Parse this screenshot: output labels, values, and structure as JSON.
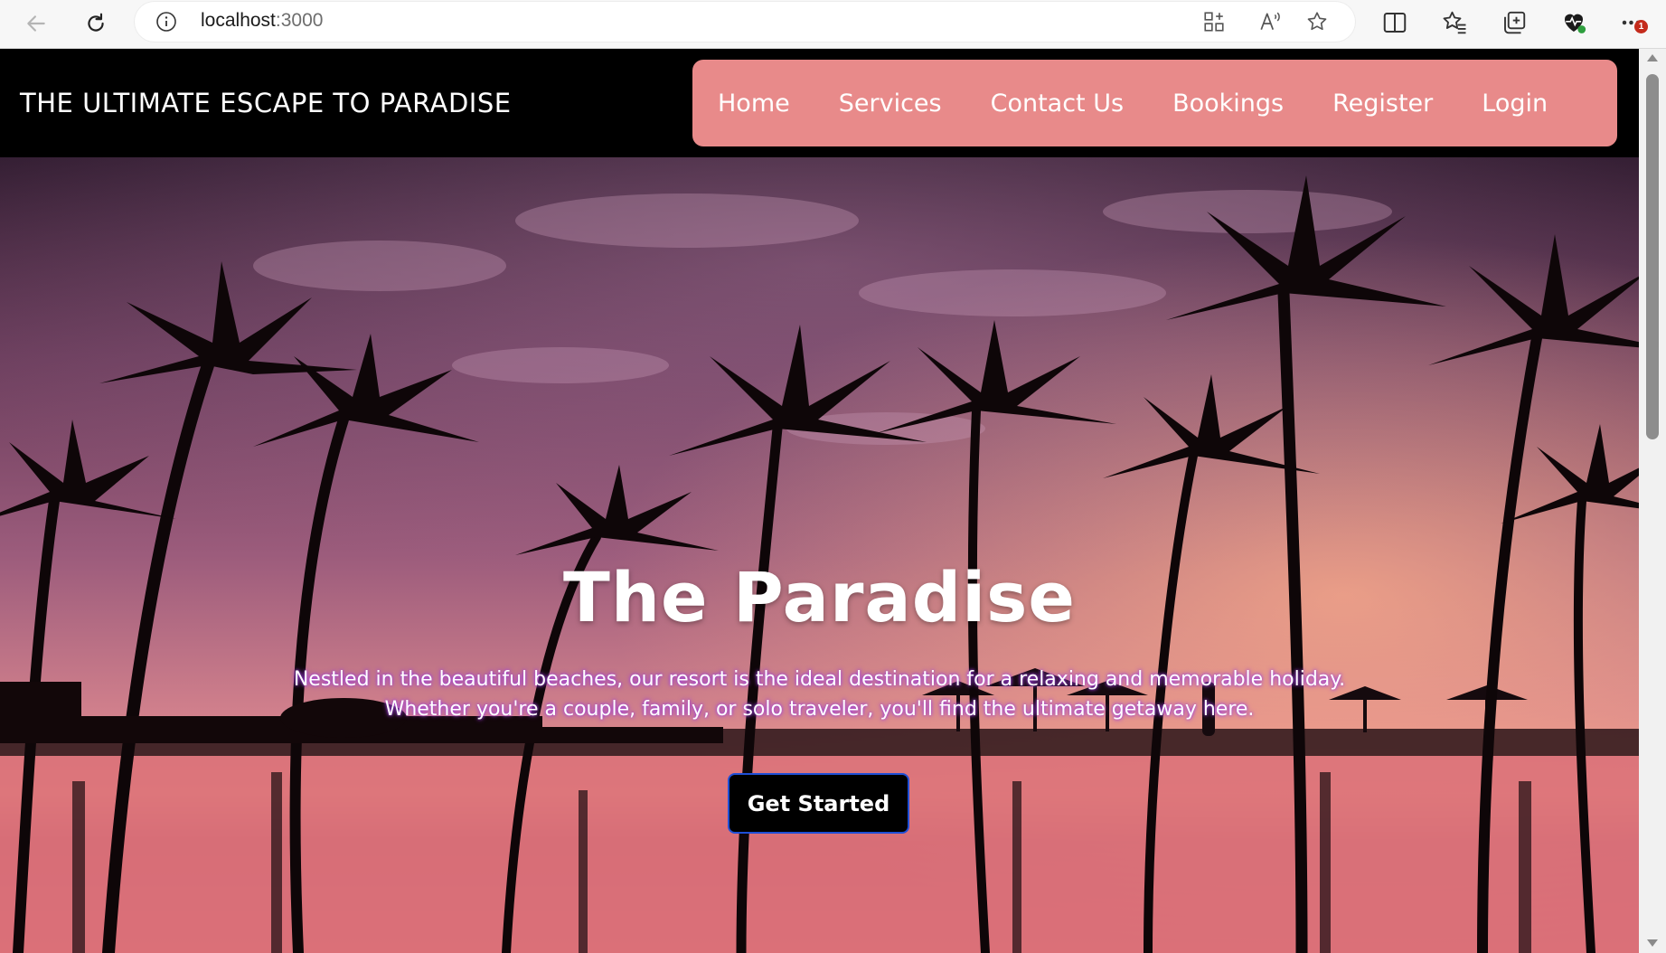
{
  "browser": {
    "url_host": "localhost",
    "url_port": ":3000",
    "notification_count": "1",
    "icons": [
      "back-icon",
      "reload-icon",
      "site-info-icon",
      "app-install-icon",
      "read-aloud-icon",
      "favorite-star-icon",
      "split-screen-icon",
      "favorites-icon",
      "collections-icon",
      "browser-essentials-icon",
      "more-menu-icon"
    ]
  },
  "site": {
    "logo": "THE ULTIMATE ESCAPE TO PARADISE",
    "nav": {
      "home": "Home",
      "services": "Services",
      "contact": "Contact Us",
      "bookings": "Bookings",
      "register": "Register",
      "login": "Login"
    }
  },
  "hero": {
    "title": "The Paradise",
    "text_line1": "Nestled in the beautiful beaches, our resort is the ideal destination for a relaxing and memorable holiday.",
    "text_line2": "Whether you're a couple, family, or solo traveler, you'll find the ultimate getaway here.",
    "cta": "Get Started"
  },
  "colors": {
    "header_bg": "#000000",
    "nav_bg": "#e88a8a",
    "cta_bg": "#000000",
    "cta_border": "#1f4fd6",
    "sky_top": "#3a2238",
    "sky_mid": "#9c5c7c",
    "sky_horizon": "#f0a08c"
  }
}
